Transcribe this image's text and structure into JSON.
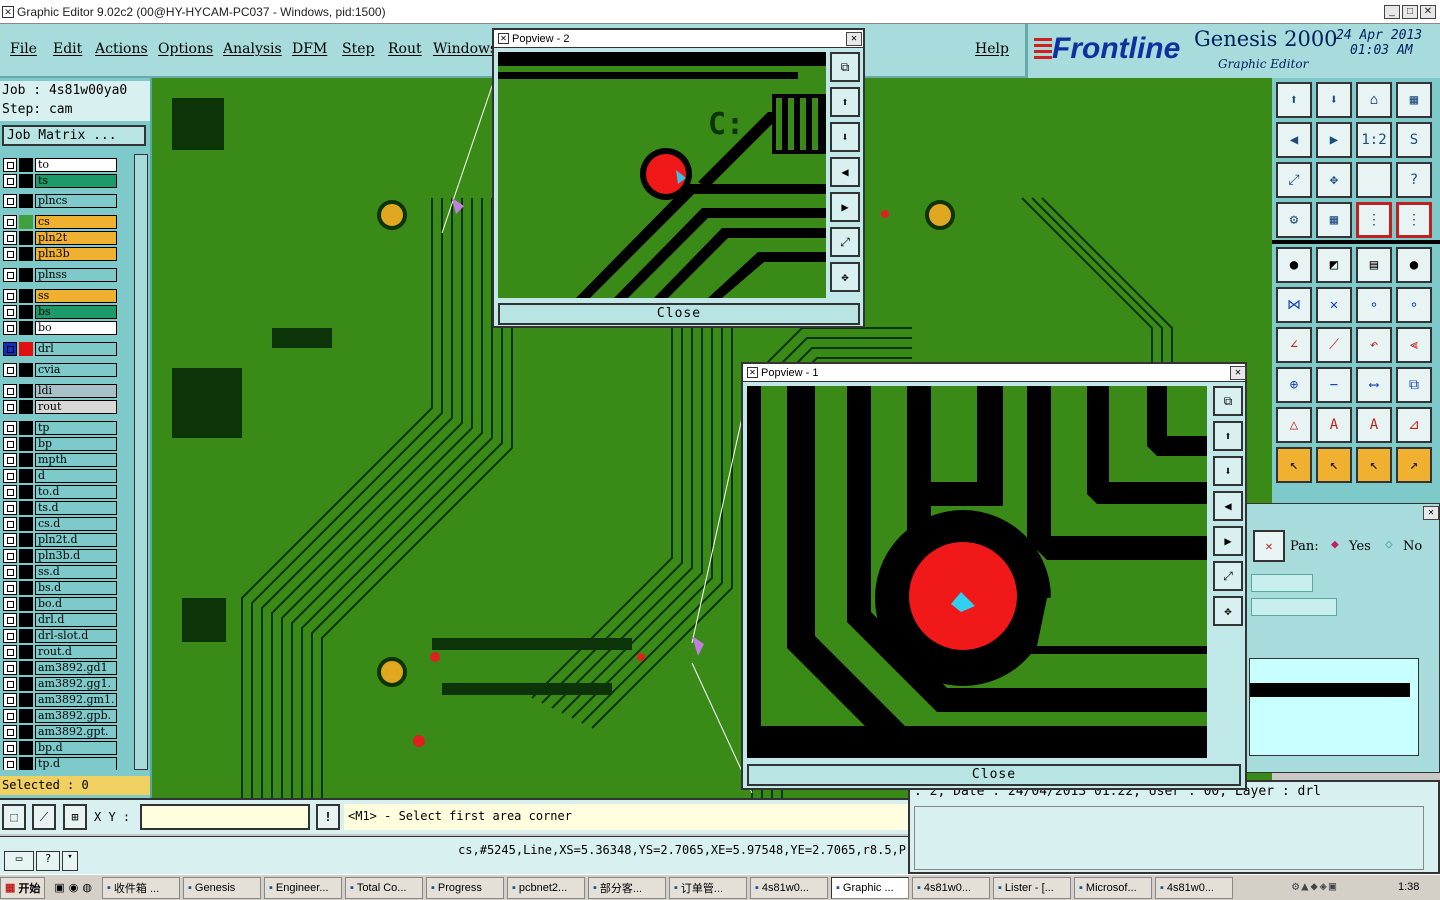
{
  "window": {
    "title": "Graphic Editor 9.02c2 (00@HY-HYCAM-PC037 - Windows, pid:1500)"
  },
  "menu": {
    "file": "File",
    "edit": "Edit",
    "actions": "Actions",
    "options": "Options",
    "analysis": "Analysis",
    "dfm": "DFM",
    "step": "Step",
    "rout": "Rout",
    "windows": "Windows",
    "help": "Help"
  },
  "brand": {
    "logo": "Frontline",
    "product": "Genesis 2000",
    "subtitle": "Graphic Editor",
    "date": "24 Apr 2013",
    "time": "01:03 AM"
  },
  "job": {
    "job_line": "Job : 4s81w00ya0",
    "step_line": "Step: cam",
    "matrix_btn": "Job Matrix ..."
  },
  "layers": [
    {
      "name": "to",
      "color": "#ffffff",
      "fg": "#000"
    },
    {
      "name": "ts",
      "color": "#1c9a6a",
      "fg": "#000"
    },
    {
      "name": "plncs",
      "color": "#7ec9c9",
      "fg": "#000"
    },
    {
      "name": "cs",
      "color": "#f0b030",
      "fg": "#000"
    },
    {
      "name": "pln2t",
      "color": "#f0b030",
      "fg": "#000"
    },
    {
      "name": "pln3b",
      "color": "#f0b030",
      "fg": "#000"
    },
    {
      "name": "plnss",
      "color": "#7ec9c9",
      "fg": "#000"
    },
    {
      "name": "ss",
      "color": "#f0b030",
      "fg": "#000"
    },
    {
      "name": "bs",
      "color": "#1c9a6a",
      "fg": "#000"
    },
    {
      "name": "bo",
      "color": "#ffffff",
      "fg": "#000"
    },
    {
      "name": "drl",
      "color": "#7ec9c9",
      "fg": "#000"
    },
    {
      "name": "cvia",
      "color": "#7ec9c9",
      "fg": "#000"
    },
    {
      "name": "ldi",
      "color": "#a8c0c8",
      "fg": "#000"
    },
    {
      "name": "rout",
      "color": "#d8d8d8",
      "fg": "#000"
    },
    {
      "name": "tp",
      "color": "#7ec9c9",
      "fg": "#000"
    },
    {
      "name": "bp",
      "color": "#7ec9c9",
      "fg": "#000"
    },
    {
      "name": "mpth",
      "color": "#7ec9c9",
      "fg": "#000"
    },
    {
      "name": "d",
      "color": "#7ec9c9",
      "fg": "#000"
    },
    {
      "name": "to.d",
      "color": "#7ec9c9",
      "fg": "#000"
    },
    {
      "name": "ts.d",
      "color": "#7ec9c9",
      "fg": "#000"
    },
    {
      "name": "cs.d",
      "color": "#7ec9c9",
      "fg": "#000"
    },
    {
      "name": "pln2t.d",
      "color": "#7ec9c9",
      "fg": "#000"
    },
    {
      "name": "pln3b.d",
      "color": "#7ec9c9",
      "fg": "#000"
    },
    {
      "name": "ss.d",
      "color": "#7ec9c9",
      "fg": "#000"
    },
    {
      "name": "bs.d",
      "color": "#7ec9c9",
      "fg": "#000"
    },
    {
      "name": "bo.d",
      "color": "#7ec9c9",
      "fg": "#000"
    },
    {
      "name": "drl.d",
      "color": "#7ec9c9",
      "fg": "#000"
    },
    {
      "name": "drl-slot.d",
      "color": "#7ec9c9",
      "fg": "#000"
    },
    {
      "name": "rout.d",
      "color": "#7ec9c9",
      "fg": "#000"
    },
    {
      "name": "am3892.gd1",
      "color": "#7ec9c9",
      "fg": "#000"
    },
    {
      "name": "am3892.gg1.",
      "color": "#7ec9c9",
      "fg": "#000"
    },
    {
      "name": "am3892.gm1.",
      "color": "#7ec9c9",
      "fg": "#000"
    },
    {
      "name": "am3892.gpb.",
      "color": "#7ec9c9",
      "fg": "#000"
    },
    {
      "name": "am3892.gpt.",
      "color": "#7ec9c9",
      "fg": "#000"
    },
    {
      "name": "bp.d",
      "color": "#7ec9c9",
      "fg": "#000"
    },
    {
      "name": "tp.d",
      "color": "#7ec9c9",
      "fg": "#000"
    }
  ],
  "selected": "Selected : 0",
  "popview2": {
    "title": "Popview - 2",
    "close": "Close",
    "label": "C:"
  },
  "popview1": {
    "title": "Popview - 1",
    "close": "Close"
  },
  "pan": {
    "label": "Pan:",
    "yes": "Yes",
    "no": "No"
  },
  "info_line": ": 2, Date : 24/04/2013 01:22, User : 00, Layer : drl",
  "status": {
    "xy_label": "X Y :",
    "prompt": "<M1> - Select first area corner",
    "feature": "cs,#5245,Line,XS=5.36348,YS=2.7065,XE=5.97548,YE=2.7065,r8.5,P"
  },
  "taskbar": {
    "start": "开始",
    "items": [
      "收件箱 ...",
      "Genesis",
      "Engineer...",
      "Total Co...",
      "Progress",
      "pcbnet2...",
      "部分客...",
      "订单管...",
      "4s81w0...",
      "Graphic ...",
      "4s81w0...",
      "Lister - [...",
      "Microsof...",
      "4s81w0..."
    ],
    "clock": "1:38"
  },
  "toolbox": {
    "scale_label": "1:2",
    "help_label": "?"
  }
}
